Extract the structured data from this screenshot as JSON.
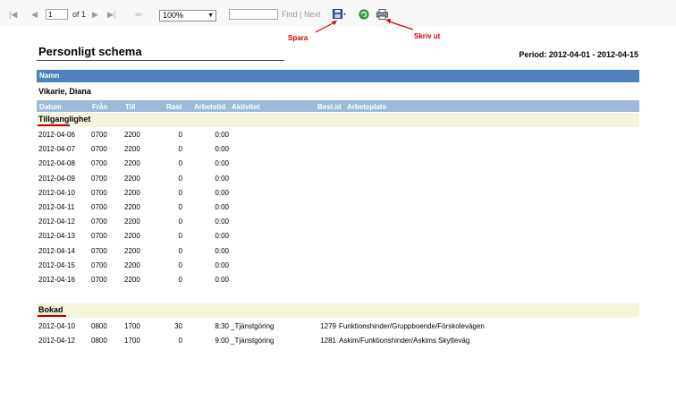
{
  "toolbar": {
    "page_value": "1",
    "of_label": "of 1",
    "zoom_value": "100%",
    "find_label": "Find",
    "separator": "|",
    "next_label": "Next"
  },
  "annotations": {
    "save": "Spara",
    "print": "Skriv ut"
  },
  "report": {
    "title": "Personligt schema",
    "period": "Period: 2012-04-01 - 2012-04-15",
    "name_header": "Namn",
    "employee": "Vikarie, Diana",
    "columns": {
      "datum": "Datum",
      "fran": "Från",
      "till": "Till",
      "rast": "Rast",
      "arbetstid": "Arbetstid",
      "aktivitet": "Aktivitet",
      "bestid": "Best.id",
      "arbetsplats": "Arbetsplats"
    },
    "sections": [
      {
        "title": "Tillganglighet",
        "rows": [
          {
            "datum": "2012-04-06",
            "fran": "0700",
            "till": "2200",
            "rast": "0",
            "arbetstid": "0:00",
            "aktivitet": "",
            "bestid": "",
            "arbetsplats": ""
          },
          {
            "datum": "2012-04-07",
            "fran": "0700",
            "till": "2200",
            "rast": "0",
            "arbetstid": "0:00",
            "aktivitet": "",
            "bestid": "",
            "arbetsplats": ""
          },
          {
            "datum": "2012-04-08",
            "fran": "0700",
            "till": "2200",
            "rast": "0",
            "arbetstid": "0:00",
            "aktivitet": "",
            "bestid": "",
            "arbetsplats": ""
          },
          {
            "datum": "2012-04-09",
            "fran": "0700",
            "till": "2200",
            "rast": "0",
            "arbetstid": "0:00",
            "aktivitet": "",
            "bestid": "",
            "arbetsplats": ""
          },
          {
            "datum": "2012-04-10",
            "fran": "0700",
            "till": "2200",
            "rast": "0",
            "arbetstid": "0:00",
            "aktivitet": "",
            "bestid": "",
            "arbetsplats": ""
          },
          {
            "datum": "2012-04-11",
            "fran": "0700",
            "till": "2200",
            "rast": "0",
            "arbetstid": "0:00",
            "aktivitet": "",
            "bestid": "",
            "arbetsplats": ""
          },
          {
            "datum": "2012-04-12",
            "fran": "0700",
            "till": "2200",
            "rast": "0",
            "arbetstid": "0:00",
            "aktivitet": "",
            "bestid": "",
            "arbetsplats": ""
          },
          {
            "datum": "2012-04-13",
            "fran": "0700",
            "till": "2200",
            "rast": "0",
            "arbetstid": "0:00",
            "aktivitet": "",
            "bestid": "",
            "arbetsplats": ""
          },
          {
            "datum": "2012-04-14",
            "fran": "0700",
            "till": "2200",
            "rast": "0",
            "arbetstid": "0:00",
            "aktivitet": "",
            "bestid": "",
            "arbetsplats": ""
          },
          {
            "datum": "2012-04-15",
            "fran": "0700",
            "till": "2200",
            "rast": "0",
            "arbetstid": "0:00",
            "aktivitet": "",
            "bestid": "",
            "arbetsplats": ""
          },
          {
            "datum": "2012-04-16",
            "fran": "0700",
            "till": "2200",
            "rast": "0",
            "arbetstid": "0:00",
            "aktivitet": "",
            "bestid": "",
            "arbetsplats": ""
          }
        ]
      },
      {
        "title": "Bokad",
        "rows": [
          {
            "datum": "2012-04-10",
            "fran": "0800",
            "till": "1700",
            "rast": "30",
            "arbetstid": "8:30",
            "aktivitet": "_Tjänstgöring",
            "bestid": "1279",
            "arbetsplats": "Funktionshinder/Gruppboende/Förskolevägen"
          },
          {
            "datum": "2012-04-12",
            "fran": "0800",
            "till": "1700",
            "rast": "0",
            "arbetstid": "9:00",
            "aktivitet": "_Tjänstgöring",
            "bestid": "1281",
            "arbetsplats": "Askim/Funktionshinder/Askims Skytteväg"
          }
        ]
      }
    ]
  }
}
